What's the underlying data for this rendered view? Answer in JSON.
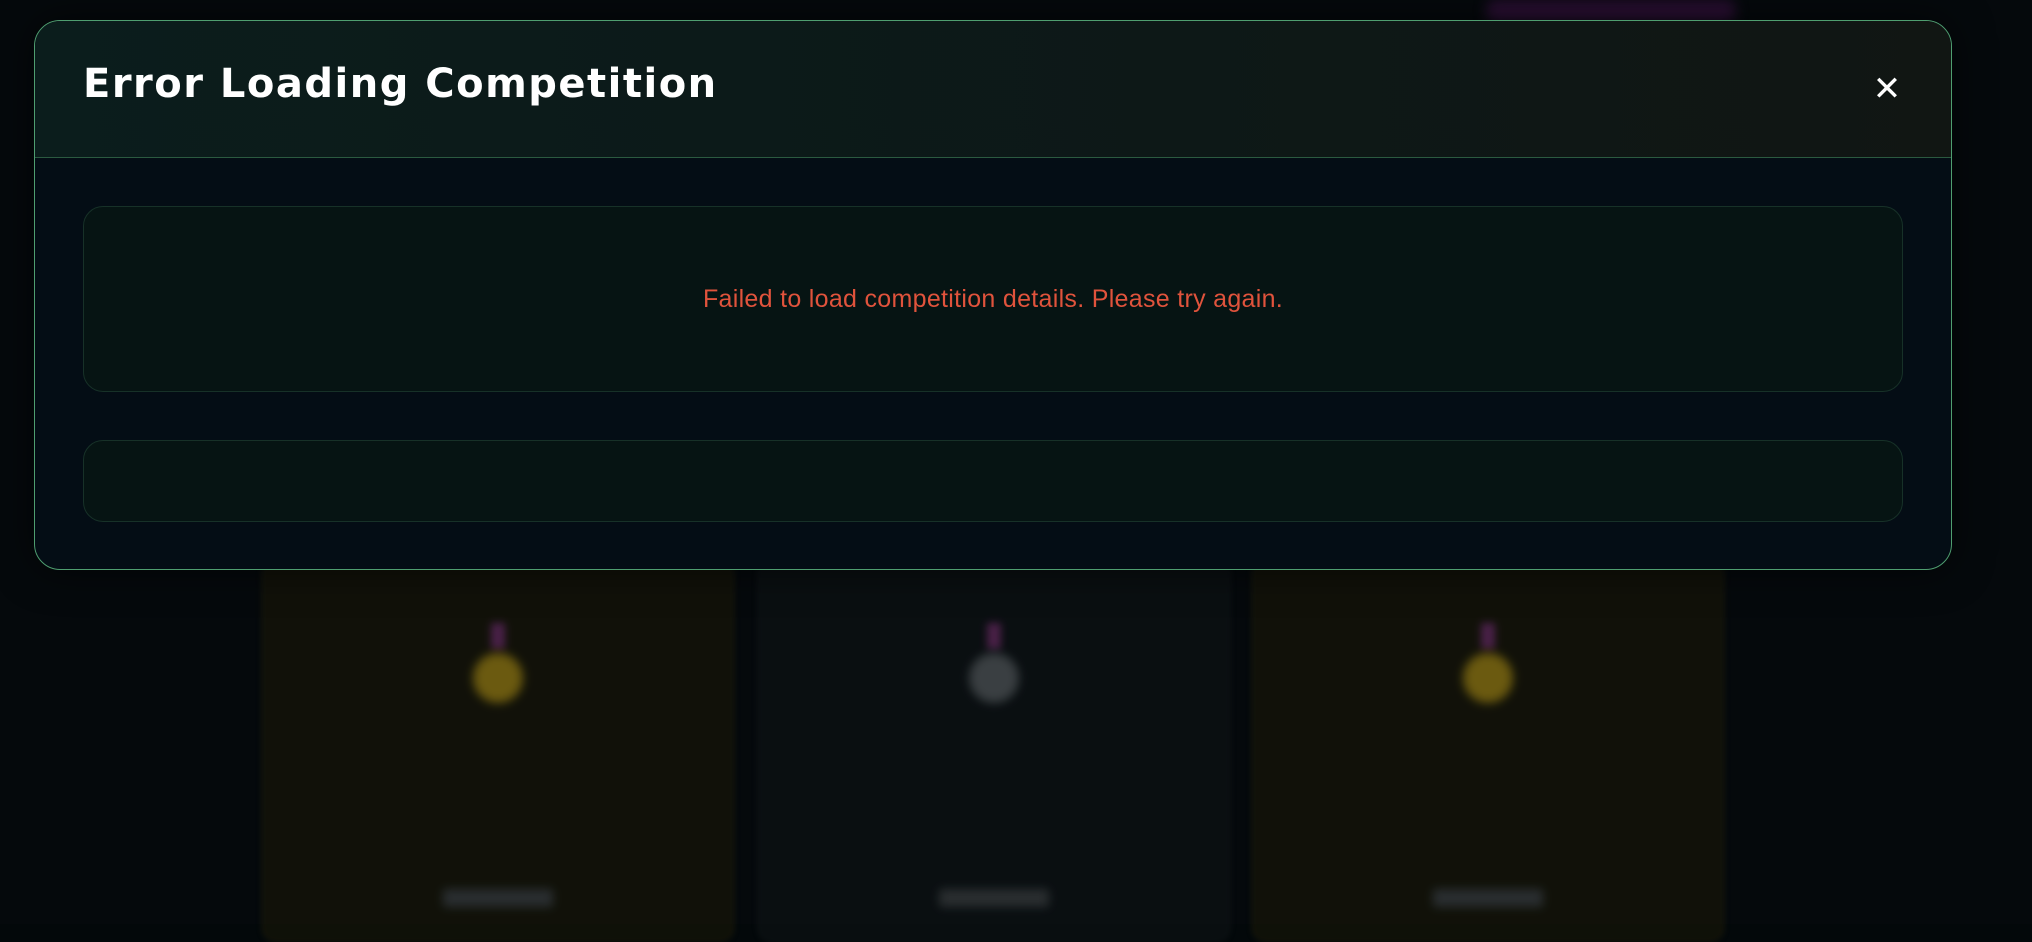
{
  "modal": {
    "title": "Error Loading Competition",
    "close_icon": "close-icon",
    "close_glyph": "✕",
    "error_message": "Failed to load competition details. Please try again."
  },
  "colors": {
    "modal_border": "#4f9e70",
    "error_text": "#e0533c",
    "title_text": "#ffffff",
    "background": "#040d15"
  }
}
